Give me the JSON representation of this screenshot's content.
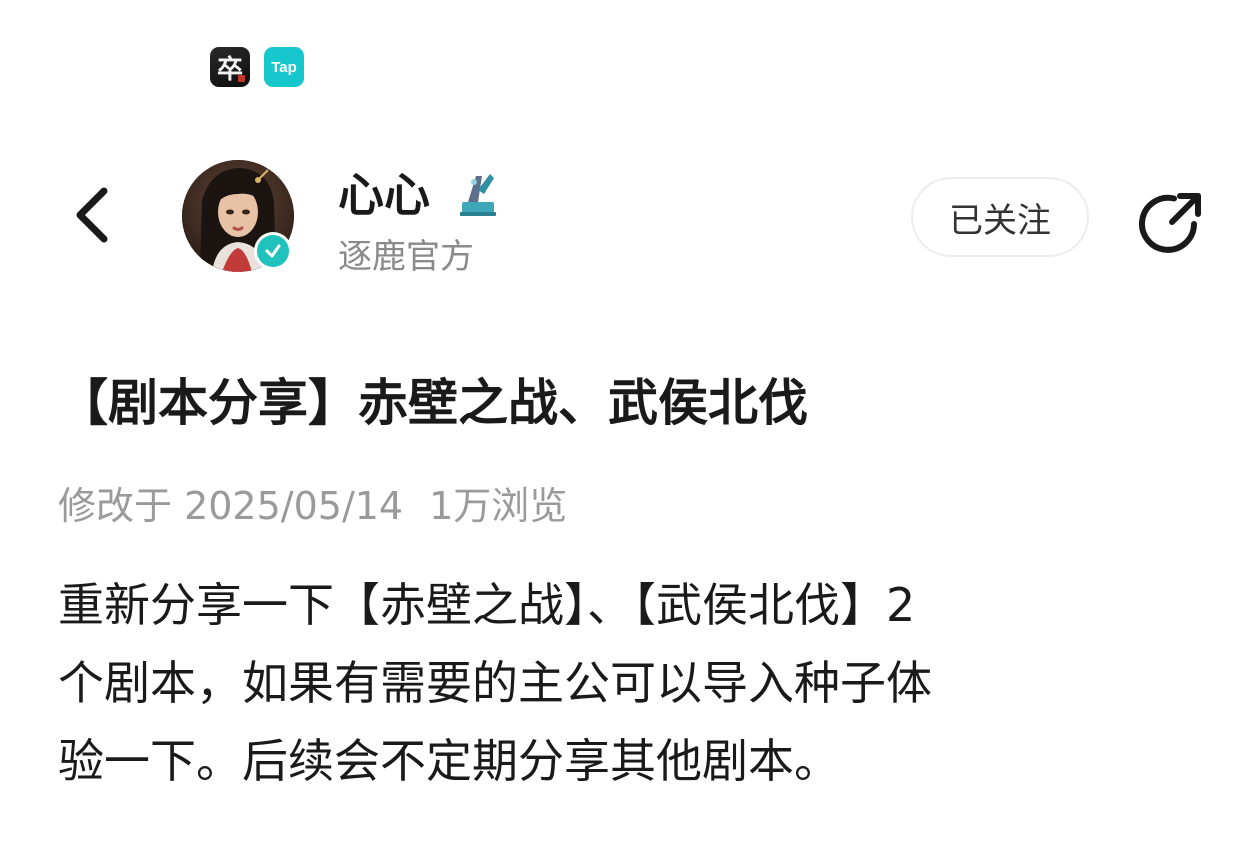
{
  "status_bar": {
    "app_icons": [
      {
        "name": "game-app-icon",
        "glyph": "卒"
      },
      {
        "name": "taptap-app-icon",
        "text": "Tap"
      }
    ]
  },
  "header": {
    "back_icon": "chevron-left-icon",
    "author_name": "心心",
    "author_subtitle": "逐鹿官方",
    "follow_label": "已关注",
    "share_icon": "share-icon",
    "badge_color": "#1fc3bb"
  },
  "post": {
    "title": "【剧本分享】赤壁之战、武侯北伐",
    "modified": "修改于 2025/05/14",
    "views": "1万浏览",
    "body_lines": [
      "重新分享一下【赤壁之战】、【武侯北伐】2",
      "个剧本，如果有需要的主公可以导入种子体",
      "验一下。后续会不定期分享其他剧本。"
    ]
  }
}
